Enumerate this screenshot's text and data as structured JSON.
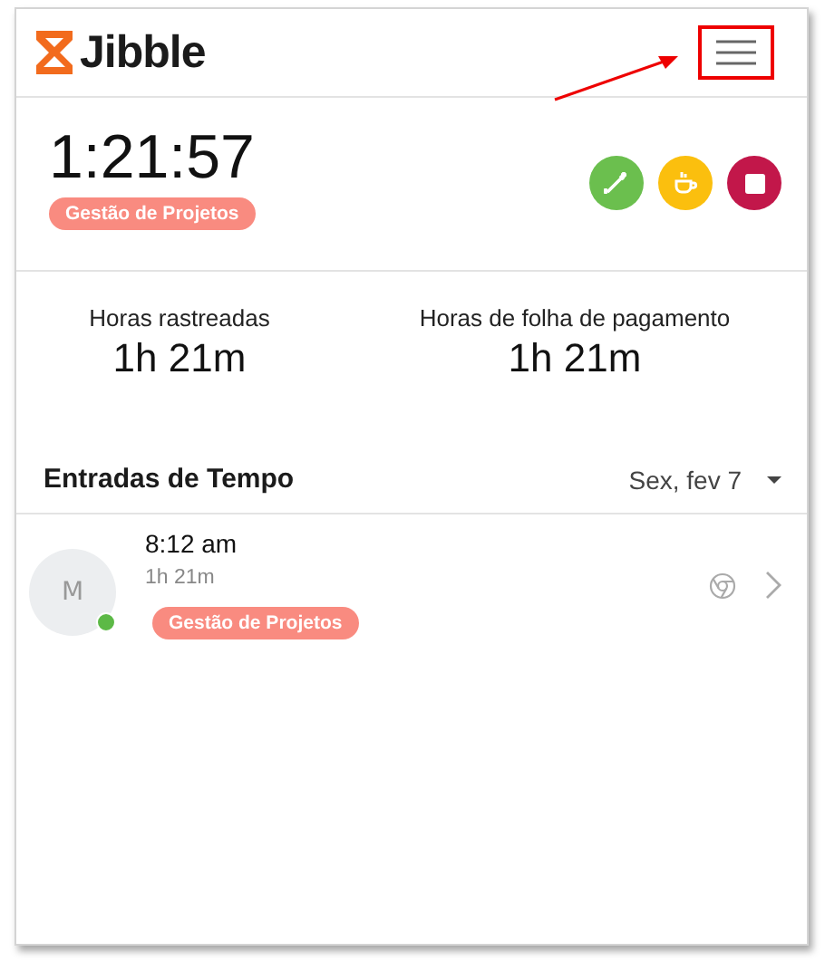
{
  "header": {
    "brand": "Jibble"
  },
  "timer": {
    "elapsed": "1:21:57",
    "project_tag": "Gestão de Projetos"
  },
  "stats": [
    {
      "label": "Horas rastreadas",
      "value": "1h 21m"
    },
    {
      "label": "Horas de folha de pagamento",
      "value": "1h 21m"
    }
  ],
  "time_entries": {
    "title": "Entradas de Tempo",
    "date": "Sex, fev 7",
    "entries": [
      {
        "avatar": "M",
        "online": true,
        "time": "8:12 am",
        "duration": "1h 21m",
        "project_tag": "Gestão de Projetos"
      }
    ]
  }
}
